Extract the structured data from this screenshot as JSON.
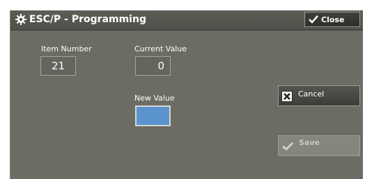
{
  "window": {
    "title": "ESC/P - Programming",
    "title_icon": "gear-icon",
    "close_label": "Close"
  },
  "item_number": {
    "label": "Item Number",
    "value": "21"
  },
  "current_value": {
    "label": "Current Value",
    "value": "0"
  },
  "new_value": {
    "label": "New Value",
    "value": ""
  },
  "buttons": {
    "cancel_label": "Cancel",
    "save_label": "Save",
    "save_enabled": false
  },
  "colors": {
    "panel": "#6c6c64",
    "title_bar": "#55554f",
    "new_value_field": "#5b93cf",
    "save_disabled": "#86867e"
  }
}
